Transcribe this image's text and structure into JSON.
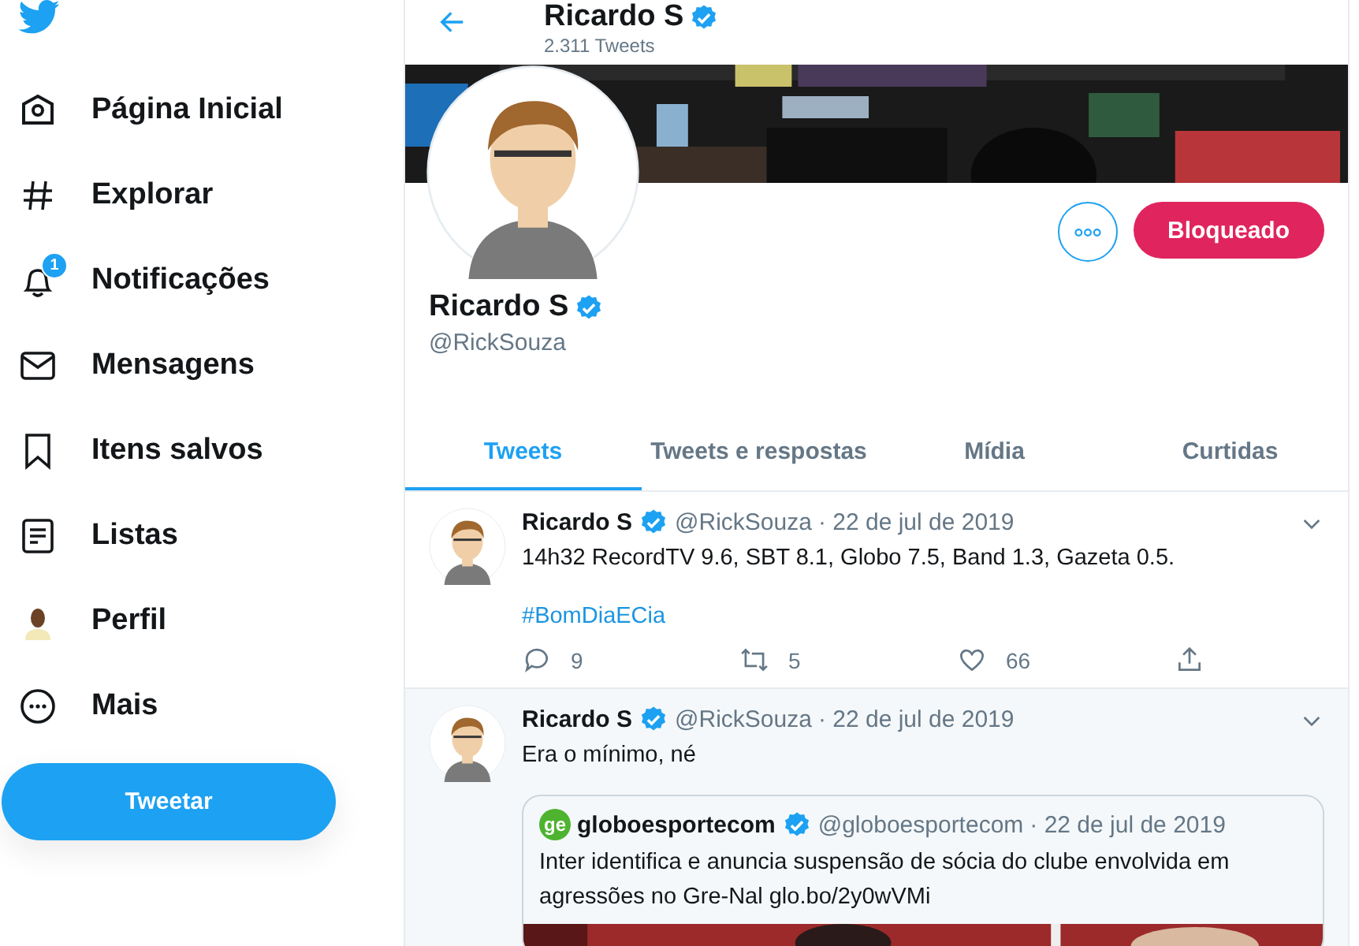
{
  "nav": [
    {
      "kind": "home",
      "label": "Página Inicial"
    },
    {
      "kind": "explore",
      "label": "Explorar"
    },
    {
      "kind": "bell",
      "label": "Notificações",
      "badge": "1"
    },
    {
      "kind": "mail",
      "label": "Mensagens"
    },
    {
      "kind": "bookmark",
      "label": "Itens salvos"
    },
    {
      "kind": "list",
      "label": "Listas"
    },
    {
      "kind": "avatar",
      "label": "Perfil"
    },
    {
      "kind": "more",
      "label": "Mais"
    }
  ],
  "tweet_button": "Tweetar",
  "header": {
    "title": "Ricardo S",
    "verified": true,
    "count": "2.311 Tweets"
  },
  "profile": {
    "name": "Ricardo S",
    "verified": true,
    "handle": "@RickSouza",
    "follow_button": "Bloqueado"
  },
  "tabs": [
    {
      "label": "Tweets",
      "selected": true
    },
    {
      "label": "Tweets e respostas",
      "selected": false
    },
    {
      "label": "Mídia",
      "selected": false
    },
    {
      "label": "Curtidas",
      "selected": false
    }
  ],
  "tweets": [
    {
      "name": "Ricardo S",
      "verified": true,
      "handle": "@RickSouza",
      "date": "· 22 de jul de 2019",
      "text": "14h32 RecordTV 9.6, SBT 8.1, Globo 7.5, Band 1.3, Gazeta 0.5.",
      "hashtag": "#BomDiaECia",
      "actions": {
        "replies": "9",
        "retweets": "5",
        "likes": "66"
      },
      "highlighted": false
    },
    {
      "name": "Ricardo S",
      "verified": true,
      "handle": "@RickSouza",
      "date": "· 22 de jul de 2019",
      "text": "Era o mínimo, né",
      "highlighted": true,
      "quote": {
        "logo": "ge",
        "name": "globoesportecom",
        "verified": true,
        "handle": "@globoesportecom",
        "date": "· 22 de jul de 2019",
        "text": "Inter identifica e anuncia suspensão de sócia do clube envolvida em agressões no Gre-Nal glo.bo/2y0wVMi"
      }
    }
  ]
}
